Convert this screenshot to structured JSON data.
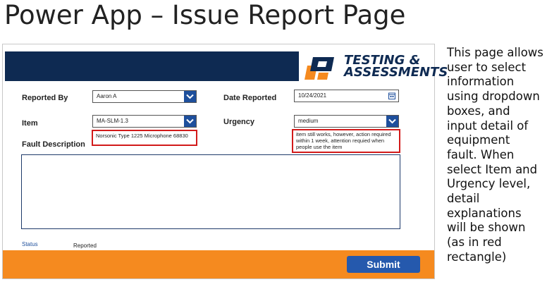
{
  "slide_title": "Power App – Issue Report Page",
  "logo": {
    "line1": "TESTING &",
    "line2": "ASSESSMENTS"
  },
  "form": {
    "reported_by": {
      "label": "Reported By",
      "value": "Aaron A"
    },
    "date_reported": {
      "label": "Date Reported",
      "value": "10/24/2021"
    },
    "item": {
      "label": "Item",
      "value": "MA-SLM-1.3",
      "detail": "Norsonic Type 1225 Microphone 68830"
    },
    "urgency": {
      "label": "Urgency",
      "value": "medium",
      "detail": "item still works, however, action required within 1 week, attention requied when people use the item"
    },
    "fault_description": {
      "label": "Fault Description",
      "value": ""
    },
    "status": {
      "label": "Status",
      "value": "Reported"
    },
    "submit_label": "Submit"
  },
  "side_note": {
    "lines": [
      "This page allows",
      "user to select",
      "information",
      "using dropdown",
      "boxes, and",
      "input detail of",
      "equipment",
      "fault. When",
      "select Item and",
      "Urgency level,",
      "detail",
      "explanations",
      "will be shown",
      "(as in red",
      "rectangle)"
    ]
  },
  "colors": {
    "header": "#0e2a52",
    "accent_blue": "#1e4f9c",
    "footer_orange": "#f58a1f",
    "highlight_red": "#d21a1a",
    "submit_blue": "#2559ad"
  },
  "icons": [
    "chevron-down-icon",
    "calendar-icon",
    "logo-mark-icon"
  ]
}
